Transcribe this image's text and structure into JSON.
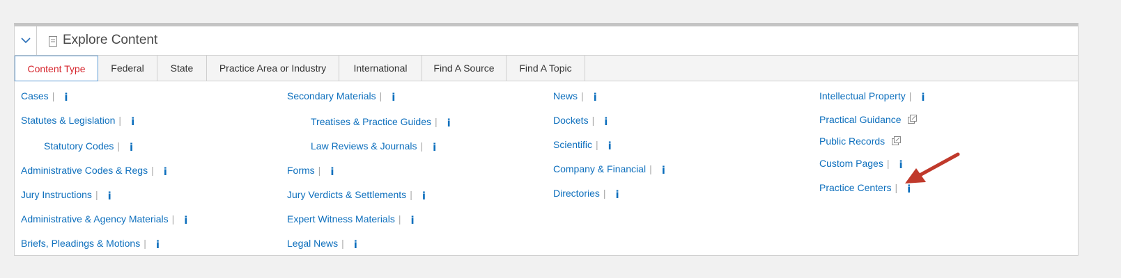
{
  "panel": {
    "title": "Explore Content"
  },
  "tabs": [
    {
      "label": "Content Type"
    },
    {
      "label": "Federal"
    },
    {
      "label": "State"
    },
    {
      "label": "Practice Area or Industry"
    },
    {
      "label": "International"
    },
    {
      "label": "Find A Source"
    },
    {
      "label": "Find A Topic"
    }
  ],
  "columns": [
    [
      {
        "label": "Cases",
        "type": "info"
      },
      {
        "label": "Statutes & Legislation",
        "type": "info"
      },
      {
        "label": "Statutory Codes",
        "type": "info"
      },
      {
        "label": "Administrative Codes & Regs",
        "type": "info"
      },
      {
        "label": "Jury Instructions",
        "type": "info"
      },
      {
        "label": "Administrative & Agency Materials",
        "type": "info"
      },
      {
        "label": "Briefs, Pleadings & Motions",
        "type": "info"
      }
    ],
    [
      {
        "label": "Secondary Materials",
        "type": "info"
      },
      {
        "label": "Treatises & Practice Guides",
        "type": "info"
      },
      {
        "label": "Law Reviews & Journals",
        "type": "info"
      },
      {
        "label": "Forms",
        "type": "info"
      },
      {
        "label": "Jury Verdicts & Settlements",
        "type": "info"
      },
      {
        "label": "Expert Witness Materials",
        "type": "info"
      },
      {
        "label": "Legal News",
        "type": "info"
      }
    ],
    [
      {
        "label": "News",
        "type": "info"
      },
      {
        "label": "Dockets",
        "type": "info"
      },
      {
        "label": "Scientific",
        "type": "info"
      },
      {
        "label": "Company & Financial",
        "type": "info"
      },
      {
        "label": "Directories",
        "type": "info"
      }
    ],
    [
      {
        "label": "Intellectual Property",
        "type": "info"
      },
      {
        "label": "Practical Guidance",
        "type": "external"
      },
      {
        "label": "Public Records",
        "type": "external"
      },
      {
        "label": "Custom Pages",
        "type": "info"
      },
      {
        "label": "Practice Centers",
        "type": "info"
      }
    ]
  ],
  "symbols": {
    "pipe": "|",
    "info": "i"
  },
  "colors": {
    "link": "#0d6fbd",
    "active_tab": "#d6262e",
    "arrow": "#c0392b"
  }
}
